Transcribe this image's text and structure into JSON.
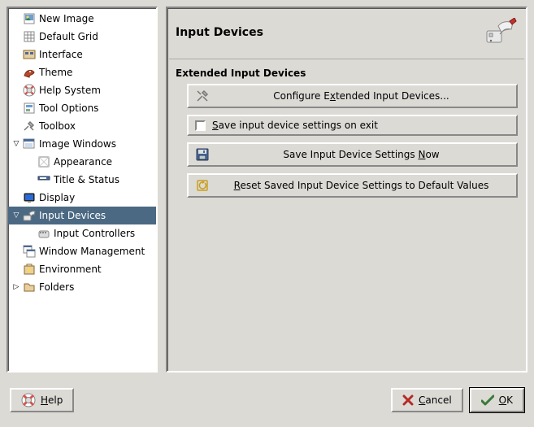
{
  "tree": {
    "items": [
      {
        "label": "New Image",
        "depth": 0,
        "expander": "",
        "icon": "newimage"
      },
      {
        "label": "Default Grid",
        "depth": 0,
        "expander": "",
        "icon": "grid"
      },
      {
        "label": "Interface",
        "depth": 0,
        "expander": "",
        "icon": "interface"
      },
      {
        "label": "Theme",
        "depth": 0,
        "expander": "",
        "icon": "theme"
      },
      {
        "label": "Help System",
        "depth": 0,
        "expander": "",
        "icon": "help"
      },
      {
        "label": "Tool Options",
        "depth": 0,
        "expander": "",
        "icon": "tooloptions"
      },
      {
        "label": "Toolbox",
        "depth": 0,
        "expander": "",
        "icon": "toolbox"
      },
      {
        "label": "Image Windows",
        "depth": 0,
        "expander": "down",
        "icon": "imagewin"
      },
      {
        "label": "Appearance",
        "depth": 1,
        "expander": "",
        "icon": "appearance"
      },
      {
        "label": "Title & Status",
        "depth": 1,
        "expander": "",
        "icon": "title"
      },
      {
        "label": "Display",
        "depth": 0,
        "expander": "",
        "icon": "display"
      },
      {
        "label": "Input Devices",
        "depth": 0,
        "expander": "down",
        "icon": "inputdev",
        "selected": true
      },
      {
        "label": "Input Controllers",
        "depth": 1,
        "expander": "",
        "icon": "controllers"
      },
      {
        "label": "Window Management",
        "depth": 0,
        "expander": "",
        "icon": "winmgmt"
      },
      {
        "label": "Environment",
        "depth": 0,
        "expander": "",
        "icon": "env"
      },
      {
        "label": "Folders",
        "depth": 0,
        "expander": "right",
        "icon": "folders"
      }
    ]
  },
  "panel": {
    "title": "Input Devices",
    "section": "Extended Input Devices",
    "configure_btn": "Configure Extended Input Devices...",
    "configure_btn_pre": "Configure E",
    "configure_btn_u": "x",
    "configure_btn_post": "tended Input Devices...",
    "checkbox_pre": "",
    "checkbox_u": "S",
    "checkbox_post": "ave input device settings on exit",
    "save_btn_pre": "Save Input Device Settings ",
    "save_btn_u": "N",
    "save_btn_post": "ow",
    "reset_btn_pre": "",
    "reset_btn_u": "R",
    "reset_btn_post": "eset Saved Input Device Settings to Default Values"
  },
  "buttons": {
    "help_u": "H",
    "help_post": "elp",
    "cancel_u": "C",
    "cancel_post": "ancel",
    "ok_u": "O",
    "ok_post": "K"
  }
}
